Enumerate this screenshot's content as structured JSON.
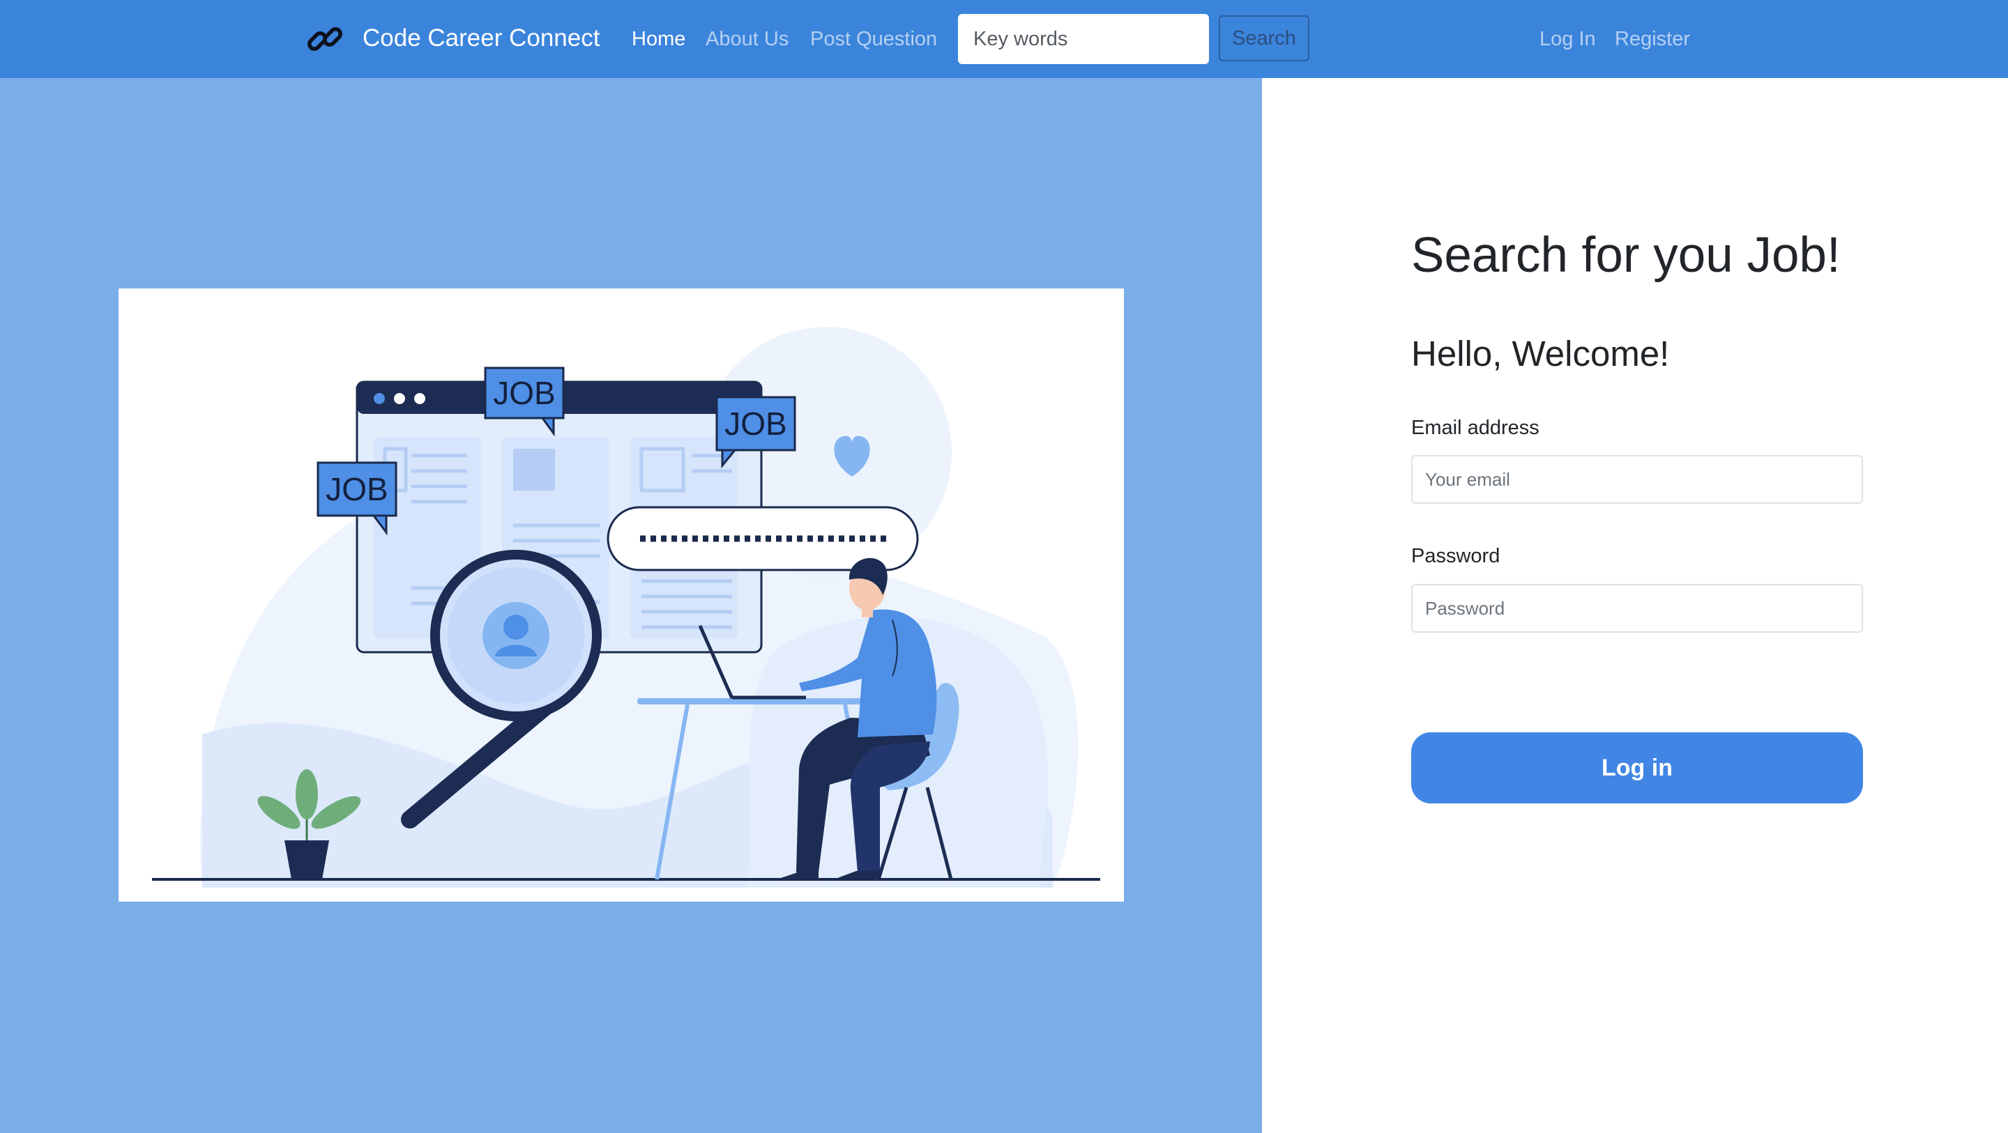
{
  "navbar": {
    "brand_name": "Code Career Connect",
    "links": [
      {
        "label": "Home",
        "active": true
      },
      {
        "label": "About Us",
        "active": false
      },
      {
        "label": "Post Question",
        "active": false
      }
    ],
    "search": {
      "value": "",
      "placeholder": "Key words",
      "button_label": "Search"
    },
    "auth_links": {
      "login": "Log In",
      "register": "Register"
    },
    "background_color": "#3b84dc",
    "brand_icon": "link-chain-icon"
  },
  "illustration": {
    "job_tags": [
      "JOB",
      "JOB",
      "JOB"
    ],
    "description_icons": [
      "magnifier-icon",
      "user-avatar-icon",
      "heart-icon",
      "plant-icon",
      "laptop-icon",
      "password-field-icon"
    ]
  },
  "login_panel": {
    "title": "Search for you Job!",
    "welcome": "Hello, Welcome!",
    "email": {
      "label": "Email address",
      "placeholder": "Your email",
      "value": ""
    },
    "password": {
      "label": "Password",
      "placeholder": "Password",
      "value": ""
    },
    "submit_label": "Log in"
  },
  "colors": {
    "accent": "#3b84dc",
    "left_panel": "#7aaee8",
    "button": "#4186e4",
    "text_dark": "#212529"
  }
}
